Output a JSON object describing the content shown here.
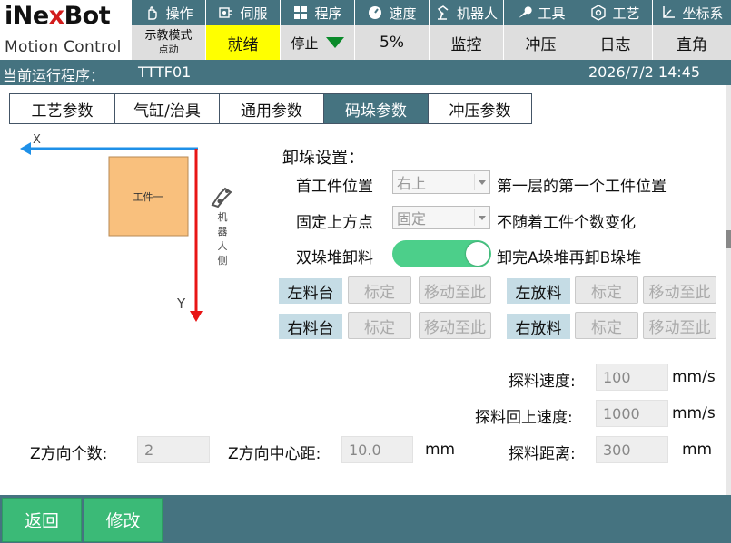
{
  "header": {
    "brand_pre": "iNe",
    "brand_x": "x",
    "brand_post": "Bot",
    "brand_sub": "Motion Control",
    "tabs": [
      {
        "label": "操作",
        "icon": "hand-icon"
      },
      {
        "label": "伺服",
        "icon": "servo-icon"
      },
      {
        "label": "程序",
        "icon": "program-grid-icon"
      },
      {
        "label": "速度",
        "icon": "gauge-icon"
      },
      {
        "label": "机器人",
        "icon": "robot-arm-icon"
      },
      {
        "label": "工具",
        "icon": "wrench-icon"
      },
      {
        "label": "工艺",
        "icon": "process-icon"
      },
      {
        "label": "坐标系",
        "icon": "coordinate-icon"
      }
    ],
    "status": {
      "mode_line1": "示教模式",
      "mode_line2": "点动",
      "ready": "就绪",
      "stop": "停止",
      "speed": "5%",
      "monitor": "监控",
      "stamping": "冲压",
      "log": "日志",
      "coord": "直角"
    },
    "colors": {
      "bar": "#457380",
      "ready": "#ffff00",
      "stop_triangle": "#0a8a2a"
    }
  },
  "info": {
    "current_program_label": "当前运行程序：",
    "program_name": "TTTF01",
    "datetime": "2026/7/2 14:45"
  },
  "subtabs": [
    {
      "label": "工艺参数",
      "active": false
    },
    {
      "label": "气缸/治具",
      "active": false
    },
    {
      "label": "通用参数",
      "active": false
    },
    {
      "label": "码垛参数",
      "active": true
    },
    {
      "label": "冲压参数",
      "active": false
    }
  ],
  "diagram": {
    "x_label": "X",
    "y_label": "Y",
    "workpiece_label": "工件一",
    "robot_side_label": [
      "机",
      "器",
      "人",
      "侧"
    ],
    "colors": {
      "x_axis": "#1e90e8",
      "y_axis": "#e81515",
      "workpiece": "#f9c07d"
    }
  },
  "unstack": {
    "title": "卸垛设置：",
    "first_pos_label": "首工件位置",
    "first_pos_value": "右上",
    "first_pos_desc": "第一层的第一个工件位置",
    "fixed_top_label": "固定上方点",
    "fixed_top_value": "固定",
    "fixed_top_desc": "不随着工件个数变化",
    "double_label": "双垛堆卸料",
    "double_on": true,
    "double_desc": "卸完A垛堆再卸B垛堆",
    "toggle_color": "#4ccf8a",
    "left_feed": "左料台",
    "right_feed": "右料台",
    "left_put": "左放料",
    "right_put": "右放料",
    "calibrate": "标定",
    "move_to": "移动至此"
  },
  "params": {
    "probe_speed_label": "探料速度:",
    "probe_speed_value": "100",
    "probe_speed_unit": "mm/s",
    "probe_up_label": "探料回上速度:",
    "probe_up_value": "1000",
    "probe_up_unit": "mm/s",
    "z_count_label": "Z方向个数:",
    "z_count_value": "2",
    "z_center_label": "Z方向中心距:",
    "z_center_value": "10.0",
    "z_center_unit": "mm",
    "probe_dist_label": "探料距离:",
    "probe_dist_value": "300",
    "probe_dist_unit": "mm"
  },
  "footer": {
    "back": "返回",
    "modify": "修改",
    "button_color": "#3bba77"
  }
}
